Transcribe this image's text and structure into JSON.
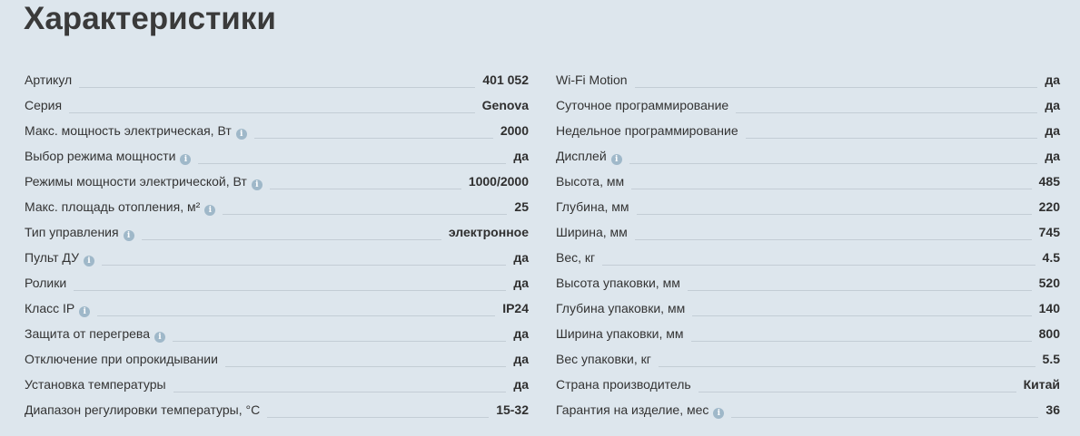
{
  "title": "Характеристики",
  "left": [
    {
      "label": "Артикул",
      "value": "401 052",
      "info": false
    },
    {
      "label": "Серия",
      "value": "Genova",
      "info": false
    },
    {
      "label": "Макс. мощность электрическая, Вт",
      "value": "2000",
      "info": true
    },
    {
      "label": "Выбор режима мощности",
      "value": "да",
      "info": true
    },
    {
      "label": "Режимы мощности электрической, Вт",
      "value": "1000/2000",
      "info": true
    },
    {
      "label": "Макс. площадь отопления, м²",
      "value": "25",
      "info": true
    },
    {
      "label": "Тип управления",
      "value": "электронное",
      "info": true
    },
    {
      "label": "Пульт ДУ",
      "value": "да",
      "info": true
    },
    {
      "label": "Ролики",
      "value": "да",
      "info": false
    },
    {
      "label": "Класс IP",
      "value": "IP24",
      "info": true
    },
    {
      "label": "Защита от перегрева",
      "value": "да",
      "info": true
    },
    {
      "label": "Отключение при опрокидывании",
      "value": "да",
      "info": false
    },
    {
      "label": "Установка температуры",
      "value": "да",
      "info": false
    },
    {
      "label": "Диапазон регулировки температуры, °С",
      "value": "15-32",
      "info": false
    }
  ],
  "right": [
    {
      "label": "Wi-Fi Motion",
      "value": "да",
      "info": false
    },
    {
      "label": "Суточное программирование",
      "value": "да",
      "info": false
    },
    {
      "label": "Недельное программирование",
      "value": "да",
      "info": false
    },
    {
      "label": "Дисплей",
      "value": "да",
      "info": true
    },
    {
      "label": "Высота, мм",
      "value": "485",
      "info": false
    },
    {
      "label": "Глубина, мм",
      "value": "220",
      "info": false
    },
    {
      "label": "Ширина, мм",
      "value": "745",
      "info": false
    },
    {
      "label": "Вес, кг",
      "value": "4.5",
      "info": false
    },
    {
      "label": "Высота упаковки, мм",
      "value": "520",
      "info": false
    },
    {
      "label": "Глубина упаковки, мм",
      "value": "140",
      "info": false
    },
    {
      "label": "Ширина упаковки, мм",
      "value": "800",
      "info": false
    },
    {
      "label": "Вес упаковки, кг",
      "value": "5.5",
      "info": false
    },
    {
      "label": "Страна производитель",
      "value": "Китай",
      "info": false
    },
    {
      "label": "Гарантия на изделие, мес",
      "value": "36",
      "info": true
    }
  ],
  "info_icon_glyph": "i",
  "colors": {
    "background": "#dde6ed",
    "info_icon": "#9fb8c9",
    "leader_line": "#c3cdd5"
  }
}
